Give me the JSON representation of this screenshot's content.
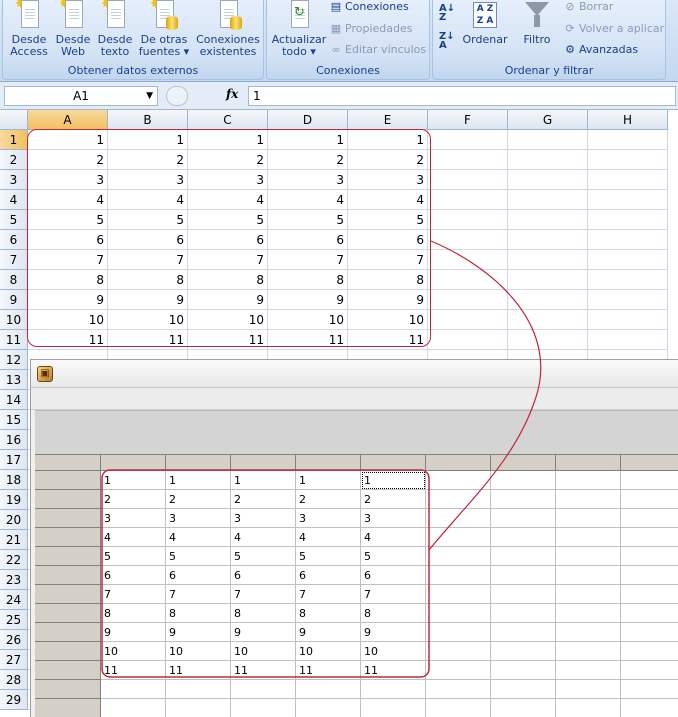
{
  "ribbon": {
    "groups": [
      {
        "label": "Obtener datos externos"
      },
      {
        "label": "Conexiones"
      },
      {
        "label": "Ordenar y filtrar"
      }
    ],
    "buttons": {
      "desde_access": {
        "line1": "Desde",
        "line2": "Access"
      },
      "desde_web": {
        "line1": "Desde",
        "line2": "Web"
      },
      "desde_texto": {
        "line1": "Desde",
        "line2": "texto"
      },
      "otras_fuentes": {
        "line1": "De otras",
        "line2": "fuentes ▾"
      },
      "conexiones_existentes": {
        "line1": "Conexiones",
        "line2": "existentes"
      },
      "actualizar_todo": {
        "line1": "Actualizar",
        "line2": "todo ▾"
      },
      "conexiones": "Conexiones",
      "propiedades": "Propiedades",
      "editar_vinculos": "Editar vínculos",
      "ordenar": "Ordenar",
      "filtro": "Filtro",
      "borrar": "Borrar",
      "volver_aplicar": "Volver a aplicar",
      "avanzadas": "Avanzadas"
    }
  },
  "formula_bar": {
    "name_box": "A1",
    "fx_label": "fx",
    "value": "1"
  },
  "sheet": {
    "columns": [
      "A",
      "B",
      "C",
      "D",
      "E",
      "F",
      "G",
      "H"
    ],
    "rows": [
      "1",
      "2",
      "3",
      "4",
      "5",
      "6",
      "7",
      "8",
      "9",
      "10",
      "11",
      "12",
      "13",
      "14",
      "15",
      "16",
      "17",
      "18",
      "19",
      "20",
      "21",
      "22",
      "23",
      "24",
      "25",
      "26",
      "27",
      "28",
      "29"
    ],
    "data": [
      [
        "1",
        "1",
        "1",
        "1",
        "1"
      ],
      [
        "2",
        "2",
        "2",
        "2",
        "2"
      ],
      [
        "3",
        "3",
        "3",
        "3",
        "3"
      ],
      [
        "4",
        "4",
        "4",
        "4",
        "4"
      ],
      [
        "5",
        "5",
        "5",
        "5",
        "5"
      ],
      [
        "6",
        "6",
        "6",
        "6",
        "6"
      ],
      [
        "7",
        "7",
        "7",
        "7",
        "7"
      ],
      [
        "8",
        "8",
        "8",
        "8",
        "8"
      ],
      [
        "9",
        "9",
        "9",
        "9",
        "9"
      ],
      [
        "10",
        "10",
        "10",
        "10",
        "10"
      ],
      [
        "11",
        "11",
        "11",
        "11",
        "11"
      ]
    ]
  },
  "window": {
    "icon": "app-icon",
    "data": [
      [
        "1",
        "1",
        "1",
        "1",
        "1"
      ],
      [
        "2",
        "2",
        "2",
        "2",
        "2"
      ],
      [
        "3",
        "3",
        "3",
        "3",
        "3"
      ],
      [
        "4",
        "4",
        "4",
        "4",
        "4"
      ],
      [
        "5",
        "5",
        "5",
        "5",
        "5"
      ],
      [
        "6",
        "6",
        "6",
        "6",
        "6"
      ],
      [
        "7",
        "7",
        "7",
        "7",
        "7"
      ],
      [
        "8",
        "8",
        "8",
        "8",
        "8"
      ],
      [
        "9",
        "9",
        "9",
        "9",
        "9"
      ],
      [
        "10",
        "10",
        "10",
        "10",
        "10"
      ],
      [
        "11",
        "11",
        "11",
        "11",
        "11"
      ]
    ]
  },
  "colors": {
    "highlight": "#c0283a",
    "ribbon_text": "#15428b"
  }
}
